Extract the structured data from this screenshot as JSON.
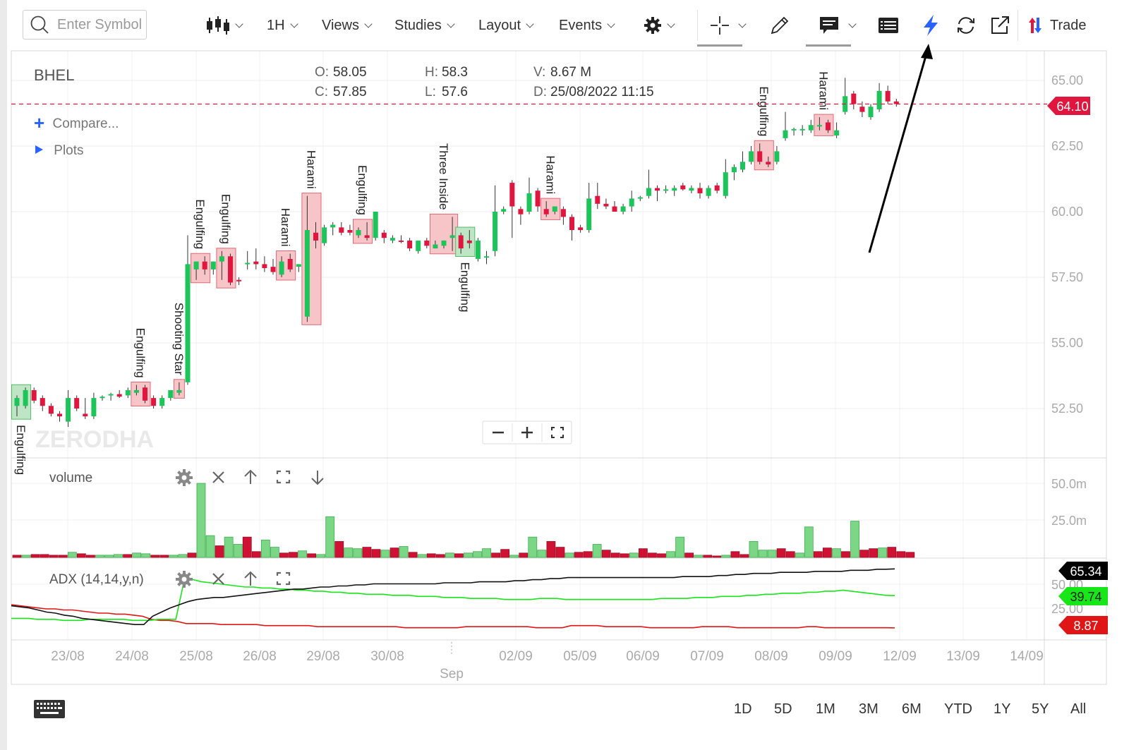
{
  "toolbar": {
    "search_placeholder": "Enter Symbol",
    "interval": "1H",
    "views": "Views",
    "studies": "Studies",
    "layout": "Layout",
    "events": "Events",
    "trade": "Trade"
  },
  "chart_info": {
    "symbol": "BHEL",
    "open_label": "O:",
    "open": "58.05",
    "close_label": "C:",
    "close": "57.85",
    "high_label": "H:",
    "high": "58.3",
    "low_label": "L:",
    "low": "57.6",
    "volume_label": "V:",
    "volume": "8.67 M",
    "date_label": "D:",
    "date": "25/08/2022 11:15",
    "compare": "Compare...",
    "plots": "Plots",
    "current_price": "64.10",
    "watermark": "ZERODHA"
  },
  "volume_panel": {
    "label": "volume"
  },
  "adx_panel": {
    "label": "ADX (14,14,y,n)",
    "adx": "65.34",
    "di_plus": "39.74",
    "di_minus": "8.87"
  },
  "timeframes": [
    "1D",
    "5D",
    "1M",
    "3M",
    "6M",
    "YTD",
    "1Y",
    "5Y",
    "All"
  ],
  "icons": {
    "chart_type": "candles-icon",
    "settings": "gear-icon",
    "crosshair": "crosshair-icon",
    "draw": "pencil-icon",
    "comment": "comment-icon",
    "table": "table-icon",
    "flash": "lightning-icon",
    "refresh": "refresh-icon",
    "popout": "external-link-icon",
    "trade": "trade-arrows-icon",
    "keyboard": "keyboard-icon"
  },
  "colors": {
    "up": "#1cc45a",
    "down": "#e0163e",
    "pattern_box": "#f5a3a8",
    "adx": "#111111",
    "di_plus": "#19e619",
    "di_minus": "#e01616",
    "flash": "#2962ff",
    "price_line": "#e0163e"
  },
  "chart_data": {
    "type": "candlestick",
    "symbol": "BHEL",
    "ylim": [
      50.5,
      66.0
    ],
    "y_ticks": [
      "65.00",
      "62.50",
      "60.00",
      "57.50",
      "55.00",
      "52.50"
    ],
    "x_ticks": [
      "23/08",
      "24/08",
      "25/08",
      "26/08",
      "29/08",
      "30/08",
      "02/09",
      "05/09",
      "06/09",
      "07/09",
      "08/09",
      "09/09",
      "12/09",
      "13/09",
      "14/09"
    ],
    "month_label": "Sep",
    "candles": [
      {
        "o": 52.6,
        "h": 53.0,
        "l": 52.2,
        "c": 52.9
      },
      {
        "o": 52.6,
        "h": 53.3,
        "l": 52.5,
        "c": 53.2
      },
      {
        "o": 53.2,
        "h": 53.3,
        "l": 52.7,
        "c": 52.8
      },
      {
        "o": 52.9,
        "h": 53.0,
        "l": 52.4,
        "c": 52.6
      },
      {
        "o": 52.6,
        "h": 52.7,
        "l": 52.2,
        "c": 52.3
      },
      {
        "o": 52.3,
        "h": 52.4,
        "l": 52.0,
        "c": 52.2
      },
      {
        "o": 52.0,
        "h": 53.2,
        "l": 51.8,
        "c": 52.9
      },
      {
        "o": 52.9,
        "h": 53.0,
        "l": 52.4,
        "c": 52.5
      },
      {
        "o": 52.3,
        "h": 52.9,
        "l": 52.1,
        "c": 52.2
      },
      {
        "o": 52.2,
        "h": 53.1,
        "l": 52.1,
        "c": 52.9
      },
      {
        "o": 52.9,
        "h": 53.0,
        "l": 52.8,
        "c": 52.95
      },
      {
        "o": 53.0,
        "h": 53.1,
        "l": 52.8,
        "c": 53.05
      },
      {
        "o": 53.05,
        "h": 53.2,
        "l": 52.9,
        "c": 52.95
      },
      {
        "o": 53.0,
        "h": 53.3,
        "l": 52.9,
        "c": 53.2
      },
      {
        "o": 53.1,
        "h": 53.4,
        "l": 53.0,
        "c": 53.2
      },
      {
        "o": 53.3,
        "h": 53.4,
        "l": 52.7,
        "c": 52.8
      },
      {
        "o": 52.9,
        "h": 53.0,
        "l": 52.5,
        "c": 52.6
      },
      {
        "o": 52.6,
        "h": 53.0,
        "l": 52.5,
        "c": 52.9
      },
      {
        "o": 52.9,
        "h": 53.2,
        "l": 52.8,
        "c": 53.2
      },
      {
        "o": 53.1,
        "h": 53.5,
        "l": 53.0,
        "c": 53.2
      },
      {
        "o": 53.5,
        "h": 59.1,
        "l": 53.4,
        "c": 58.0
      },
      {
        "o": 57.8,
        "h": 58.1,
        "l": 57.4,
        "c": 58.1
      },
      {
        "o": 58.1,
        "h": 58.3,
        "l": 57.6,
        "c": 57.8
      },
      {
        "o": 57.8,
        "h": 58.1,
        "l": 57.6,
        "c": 58.1
      },
      {
        "o": 58.1,
        "h": 58.5,
        "l": 57.4,
        "c": 58.3
      },
      {
        "o": 58.3,
        "h": 58.4,
        "l": 57.2,
        "c": 57.3
      },
      {
        "o": 57.4,
        "h": 57.5,
        "l": 57.2,
        "c": 57.35
      },
      {
        "o": 58.0,
        "h": 58.5,
        "l": 57.8,
        "c": 58.05
      },
      {
        "o": 58.1,
        "h": 58.6,
        "l": 57.8,
        "c": 58.0
      },
      {
        "o": 58.0,
        "h": 58.3,
        "l": 57.7,
        "c": 57.85
      },
      {
        "o": 57.9,
        "h": 58.2,
        "l": 57.6,
        "c": 57.7
      },
      {
        "o": 57.6,
        "h": 58.3,
        "l": 57.5,
        "c": 58.1
      },
      {
        "o": 58.2,
        "h": 58.4,
        "l": 57.7,
        "c": 57.8
      },
      {
        "o": 57.9,
        "h": 58.0,
        "l": 57.7,
        "c": 58.0
      },
      {
        "o": 56.0,
        "h": 60.6,
        "l": 55.8,
        "c": 59.3
      },
      {
        "o": 59.2,
        "h": 59.6,
        "l": 58.6,
        "c": 58.9
      },
      {
        "o": 58.8,
        "h": 59.5,
        "l": 58.7,
        "c": 59.4
      },
      {
        "o": 59.4,
        "h": 59.6,
        "l": 59.1,
        "c": 59.5
      },
      {
        "o": 59.4,
        "h": 59.6,
        "l": 59.1,
        "c": 59.2
      },
      {
        "o": 59.3,
        "h": 59.5,
        "l": 59.1,
        "c": 59.2
      },
      {
        "o": 59.1,
        "h": 59.4,
        "l": 59.0,
        "c": 59.3
      },
      {
        "o": 59.1,
        "h": 59.6,
        "l": 58.9,
        "c": 59.0
      },
      {
        "o": 59.0,
        "h": 60.0,
        "l": 58.9,
        "c": 60.0
      },
      {
        "o": 59.2,
        "h": 59.3,
        "l": 58.8,
        "c": 59.0
      },
      {
        "o": 58.9,
        "h": 59.1,
        "l": 58.8,
        "c": 59.0
      },
      {
        "o": 58.9,
        "h": 59.1,
        "l": 58.8,
        "c": 58.85
      },
      {
        "o": 58.9,
        "h": 59.0,
        "l": 58.5,
        "c": 58.6
      },
      {
        "o": 58.5,
        "h": 58.9,
        "l": 58.4,
        "c": 58.9
      },
      {
        "o": 58.9,
        "h": 59.0,
        "l": 58.6,
        "c": 58.7
      },
      {
        "o": 58.6,
        "h": 58.9,
        "l": 58.6,
        "c": 58.75
      },
      {
        "o": 58.7,
        "h": 58.9,
        "l": 58.6,
        "c": 58.9
      },
      {
        "o": 59.0,
        "h": 59.8,
        "l": 58.5,
        "c": 59.1
      },
      {
        "o": 59.1,
        "h": 59.2,
        "l": 58.4,
        "c": 58.6
      },
      {
        "o": 58.9,
        "h": 59.3,
        "l": 58.6,
        "c": 58.8
      },
      {
        "o": 58.2,
        "h": 59.0,
        "l": 58.1,
        "c": 58.9
      },
      {
        "o": 58.3,
        "h": 58.5,
        "l": 58.0,
        "c": 58.3
      },
      {
        "o": 58.5,
        "h": 61.0,
        "l": 58.3,
        "c": 60.0
      },
      {
        "o": 60.0,
        "h": 60.2,
        "l": 59.9,
        "c": 60.1
      },
      {
        "o": 61.1,
        "h": 61.2,
        "l": 59.0,
        "c": 60.2
      },
      {
        "o": 60.1,
        "h": 60.2,
        "l": 59.5,
        "c": 59.9
      },
      {
        "o": 60.0,
        "h": 61.3,
        "l": 59.9,
        "c": 60.7
      },
      {
        "o": 60.8,
        "h": 60.9,
        "l": 60.0,
        "c": 60.2
      },
      {
        "o": 60.1,
        "h": 60.4,
        "l": 59.8,
        "c": 59.9
      },
      {
        "o": 60.0,
        "h": 60.2,
        "l": 59.9,
        "c": 60.2
      },
      {
        "o": 60.1,
        "h": 60.2,
        "l": 59.5,
        "c": 59.8
      },
      {
        "o": 59.8,
        "h": 59.9,
        "l": 58.9,
        "c": 59.3
      },
      {
        "o": 59.4,
        "h": 59.5,
        "l": 59.2,
        "c": 59.3
      },
      {
        "o": 59.3,
        "h": 61.1,
        "l": 59.2,
        "c": 60.5
      },
      {
        "o": 60.6,
        "h": 61.1,
        "l": 60.1,
        "c": 60.3
      },
      {
        "o": 60.3,
        "h": 60.5,
        "l": 60.1,
        "c": 60.2
      },
      {
        "o": 60.2,
        "h": 60.4,
        "l": 60.0,
        "c": 60.0
      },
      {
        "o": 60.0,
        "h": 60.3,
        "l": 59.9,
        "c": 60.2
      },
      {
        "o": 60.2,
        "h": 60.8,
        "l": 60.0,
        "c": 60.5
      },
      {
        "o": 60.5,
        "h": 60.6,
        "l": 60.4,
        "c": 60.55
      },
      {
        "o": 60.6,
        "h": 61.6,
        "l": 60.5,
        "c": 60.9
      },
      {
        "o": 60.9,
        "h": 61.0,
        "l": 60.4,
        "c": 60.8
      },
      {
        "o": 60.8,
        "h": 61.0,
        "l": 60.7,
        "c": 60.85
      },
      {
        "o": 60.8,
        "h": 61.0,
        "l": 60.6,
        "c": 60.9
      },
      {
        "o": 61.0,
        "h": 61.1,
        "l": 60.8,
        "c": 60.85
      },
      {
        "o": 60.8,
        "h": 61.0,
        "l": 60.7,
        "c": 60.9
      },
      {
        "o": 60.9,
        "h": 61.1,
        "l": 60.5,
        "c": 60.7
      },
      {
        "o": 60.6,
        "h": 61.0,
        "l": 60.5,
        "c": 60.9
      },
      {
        "o": 61.0,
        "h": 61.1,
        "l": 60.7,
        "c": 60.8
      },
      {
        "o": 60.6,
        "h": 62.0,
        "l": 60.5,
        "c": 61.5
      },
      {
        "o": 61.5,
        "h": 61.8,
        "l": 61.2,
        "c": 61.7
      },
      {
        "o": 61.6,
        "h": 62.3,
        "l": 61.5,
        "c": 61.9
      },
      {
        "o": 61.9,
        "h": 62.5,
        "l": 61.8,
        "c": 62.3
      },
      {
        "o": 62.3,
        "h": 62.6,
        "l": 61.8,
        "c": 61.9
      },
      {
        "o": 61.9,
        "h": 62.1,
        "l": 61.7,
        "c": 61.8
      },
      {
        "o": 61.9,
        "h": 62.5,
        "l": 61.8,
        "c": 62.3
      },
      {
        "o": 62.8,
        "h": 63.8,
        "l": 62.7,
        "c": 63.1
      },
      {
        "o": 63.1,
        "h": 63.2,
        "l": 62.9,
        "c": 63.15
      },
      {
        "o": 63.1,
        "h": 63.3,
        "l": 62.9,
        "c": 63.15
      },
      {
        "o": 63.1,
        "h": 63.5,
        "l": 63.0,
        "c": 63.3
      },
      {
        "o": 63.3,
        "h": 63.6,
        "l": 63.1,
        "c": 63.3
      },
      {
        "o": 63.4,
        "h": 63.5,
        "l": 63.0,
        "c": 63.1
      },
      {
        "o": 62.9,
        "h": 63.4,
        "l": 62.8,
        "c": 63.1
      },
      {
        "o": 63.8,
        "h": 65.1,
        "l": 63.7,
        "c": 64.4
      },
      {
        "o": 64.5,
        "h": 64.6,
        "l": 63.9,
        "c": 64.1
      },
      {
        "o": 64.0,
        "h": 64.2,
        "l": 63.6,
        "c": 63.8
      },
      {
        "o": 63.6,
        "h": 64.1,
        "l": 63.5,
        "c": 64.0
      },
      {
        "o": 63.9,
        "h": 64.9,
        "l": 63.8,
        "c": 64.6
      },
      {
        "o": 64.6,
        "h": 64.8,
        "l": 64.1,
        "c": 64.2
      },
      {
        "o": 64.2,
        "h": 64.3,
        "l": 64.0,
        "c": 64.1
      }
    ],
    "patterns": [
      {
        "label": "Engulfing",
        "start": 0,
        "end": 1,
        "type": "bullish"
      },
      {
        "label": "Engulfing",
        "start": 14,
        "end": 15,
        "type": "bearish"
      },
      {
        "label": "Shooting Star",
        "start": 19,
        "end": 19,
        "type": "bearish"
      },
      {
        "label": "Engulfing",
        "start": 21,
        "end": 22,
        "type": "bearish"
      },
      {
        "label": "Engulfing",
        "start": 24,
        "end": 25,
        "type": "bearish"
      },
      {
        "label": "Harami",
        "start": 31,
        "end": 32,
        "type": "bearish"
      },
      {
        "label": "Harami",
        "start": 34,
        "end": 35,
        "type": "bearish"
      },
      {
        "label": "Engulfing",
        "start": 40,
        "end": 41,
        "type": "bearish"
      },
      {
        "label": "Three Inside",
        "start": 49,
        "end": 51,
        "type": "bearish"
      },
      {
        "label": "Engulfing",
        "start": 52,
        "end": 53,
        "type": "bullish"
      },
      {
        "label": "Harami",
        "start": 62,
        "end": 63,
        "type": "bearish"
      },
      {
        "label": "Engulfing",
        "start": 87,
        "end": 88,
        "type": "bearish"
      },
      {
        "label": "Harami",
        "start": 94,
        "end": 95,
        "type": "bearish"
      }
    ],
    "volume": {
      "y_ticks": [
        "50.0m",
        "25.0m"
      ],
      "ylim": [
        0,
        60
      ],
      "values": [
        1.5,
        1.5,
        2.0,
        2.0,
        1.5,
        1.5,
        3.5,
        2.5,
        1.5,
        1.5,
        1.5,
        2.0,
        2.0,
        3.0,
        2.5,
        1.5,
        1.5,
        1.5,
        2.0,
        3.0,
        51.0,
        15.0,
        8.0,
        14.0,
        9.0,
        14.0,
        4.0,
        12.0,
        7.0,
        3.0,
        3.5,
        4.5,
        2.5,
        2.0,
        28.0,
        11.0,
        6.5,
        6.0,
        7.0,
        5.5,
        5.0,
        6.5,
        7.5,
        3.5,
        2.0,
        2.5,
        2.0,
        3.0,
        2.5,
        3.0,
        4.0,
        6.0,
        3.0,
        5.5,
        1.5,
        3.0,
        14.0,
        5.0,
        11.0,
        7.0,
        3.0,
        3.5,
        4.0,
        9.0,
        5.0,
        3.0,
        2.5,
        3.0,
        6.0,
        3.0,
        2.5,
        4.0,
        14.0,
        3.0,
        1.5,
        1.5,
        1.0,
        1.5,
        4.0,
        2.0,
        11.0,
        5.0,
        5.0,
        6.0,
        4.0,
        3.0,
        21.0,
        4.0,
        6.5,
        6.0,
        4.0,
        25.0,
        5.0,
        6.0,
        6.5,
        7.0,
        4.0,
        3.5
      ],
      "down": [
        true,
        false,
        true,
        true,
        true,
        true,
        false,
        true,
        true,
        false,
        false,
        false,
        true,
        false,
        false,
        true,
        true,
        false,
        false,
        true,
        false,
        false,
        true,
        false,
        false,
        true,
        true,
        false,
        false,
        true,
        true,
        false,
        true,
        false,
        false,
        true,
        false,
        false,
        true,
        true,
        false,
        true,
        false,
        true,
        false,
        true,
        true,
        false,
        true,
        false,
        false,
        false,
        true,
        true,
        false,
        true,
        false,
        false,
        true,
        true,
        false,
        true,
        true,
        false,
        true,
        true,
        true,
        false,
        true,
        true,
        true,
        false,
        false,
        true,
        false,
        true,
        true,
        false,
        true,
        true,
        false,
        false,
        false,
        true,
        true,
        false,
        false,
        true,
        true,
        false,
        true,
        false,
        true,
        true,
        false,
        true,
        true,
        true
      ]
    },
    "adx": {
      "ylim": [
        0,
        100
      ],
      "y_ticks": [
        "50.00",
        "25.00"
      ],
      "adx": [
        30,
        29,
        28,
        26,
        24,
        23,
        21,
        20,
        18,
        17,
        16,
        15,
        14,
        13,
        12,
        12,
        20,
        24,
        28,
        31,
        34,
        36,
        37,
        38,
        38,
        39,
        40,
        41,
        42,
        43,
        44,
        45,
        46,
        46,
        47,
        48,
        48,
        49,
        49,
        50,
        50,
        51,
        51,
        51,
        51,
        51,
        51,
        51,
        51,
        52,
        52,
        52,
        52,
        53,
        53,
        53,
        53,
        54,
        54,
        55,
        55,
        56,
        56,
        57,
        57,
        57,
        57,
        57,
        57,
        57,
        57,
        57,
        57,
        57,
        57,
        57,
        58,
        58,
        58,
        58,
        59,
        59,
        60,
        60,
        61,
        61,
        61,
        62,
        62,
        62,
        62,
        63,
        63,
        63,
        63,
        64,
        64,
        64,
        65,
        65,
        65.34
      ],
      "di_plus": [
        18,
        18,
        18,
        17,
        17,
        17,
        16,
        16,
        16,
        17,
        17,
        17,
        17,
        17,
        16,
        16,
        16,
        17,
        17,
        17,
        56,
        55,
        53,
        52,
        51,
        50,
        49,
        48,
        48,
        47,
        47,
        46,
        46,
        45,
        45,
        44,
        44,
        43,
        43,
        42,
        42,
        41,
        41,
        41,
        40,
        40,
        40,
        39,
        39,
        39,
        38,
        38,
        38,
        37,
        37,
        37,
        37,
        36,
        36,
        36,
        36,
        37,
        37,
        37,
        36,
        36,
        36,
        36,
        36,
        36,
        36,
        36,
        36,
        36,
        36,
        37,
        37,
        37,
        37,
        38,
        38,
        38,
        39,
        39,
        39,
        40,
        40,
        41,
        41,
        42,
        42,
        42,
        43,
        43,
        44,
        44,
        45,
        44,
        43,
        42,
        41,
        40,
        39.74
      ],
      "di_minus": [
        31,
        30,
        29,
        28,
        27,
        27,
        26,
        26,
        25,
        24,
        23,
        23,
        22,
        22,
        21,
        20,
        17,
        16,
        16,
        15,
        13,
        13,
        13,
        13,
        12,
        12,
        12,
        12,
        12,
        11,
        11,
        11,
        11,
        11,
        11,
        10,
        10,
        10,
        10,
        10,
        10,
        10,
        10,
        10,
        10,
        9,
        9,
        9,
        9,
        9,
        9,
        9,
        10,
        10,
        10,
        10,
        10,
        10,
        10,
        10,
        9,
        9,
        9,
        9,
        11,
        11,
        11,
        11,
        10,
        10,
        10,
        10,
        10,
        9,
        9,
        9,
        9,
        9,
        9,
        10,
        10,
        10,
        10,
        9,
        9,
        9,
        9,
        9,
        9,
        9,
        9,
        10,
        10,
        9,
        9,
        9,
        9,
        9,
        9,
        9,
        9,
        8.87
      ]
    }
  }
}
